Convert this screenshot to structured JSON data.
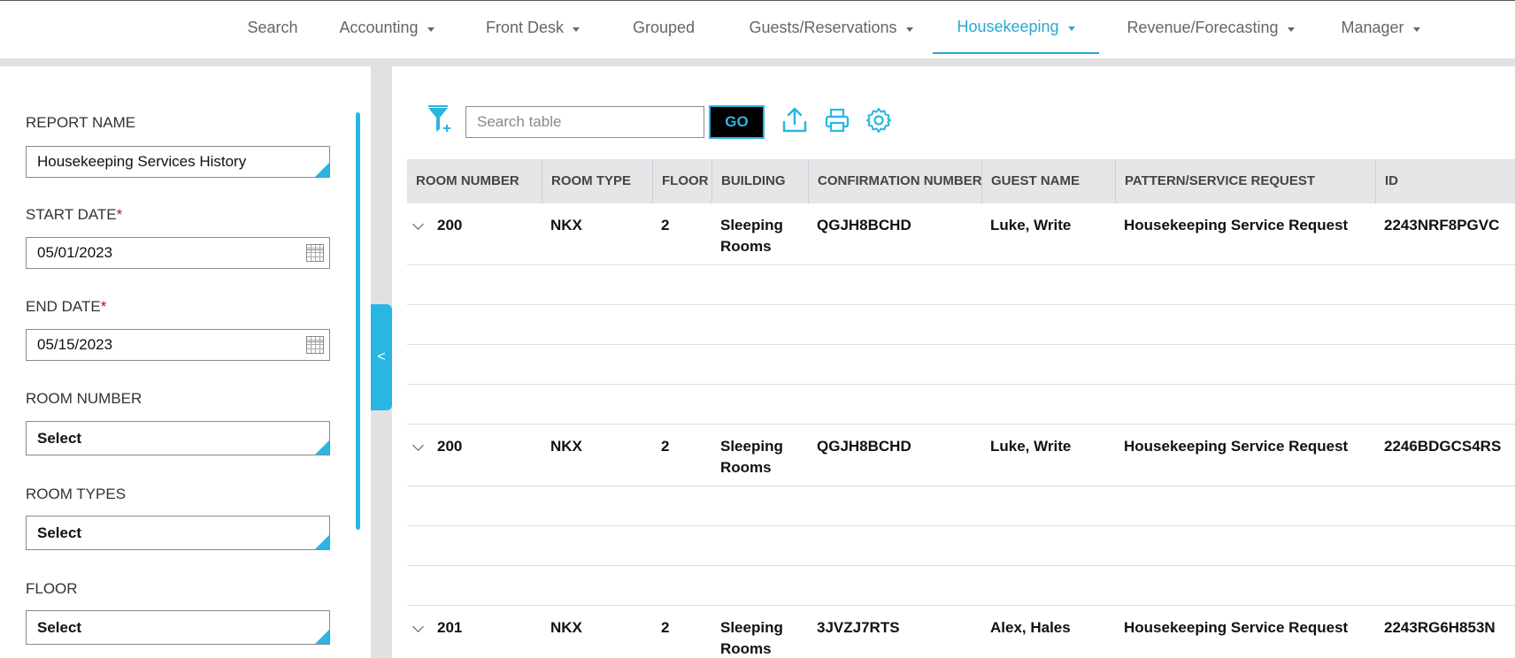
{
  "nav": {
    "items": [
      {
        "label": "Search",
        "dropdown": false,
        "active": false
      },
      {
        "label": "Accounting",
        "dropdown": true,
        "active": false
      },
      {
        "label": "Front Desk",
        "dropdown": true,
        "active": false
      },
      {
        "label": "Grouped",
        "dropdown": false,
        "active": false
      },
      {
        "label": "Guests/Reservations",
        "dropdown": true,
        "active": false
      },
      {
        "label": "Housekeeping",
        "dropdown": true,
        "active": true
      },
      {
        "label": "Revenue/Forecasting",
        "dropdown": true,
        "active": false
      },
      {
        "label": "Manager",
        "dropdown": true,
        "active": false
      }
    ]
  },
  "filters": {
    "report_name_label": "REPORT NAME",
    "report_name_value": "Housekeeping Services History",
    "start_date_label": "START DATE",
    "start_date_value": "05/01/2023",
    "end_date_label": "END DATE",
    "end_date_value": "05/15/2023",
    "required_mark": "*",
    "room_number_label": "ROOM NUMBER",
    "room_number_value": "Select",
    "room_types_label": "ROOM TYPES",
    "room_types_value": "Select",
    "floor_label": "FLOOR",
    "floor_value": "Select"
  },
  "collapse_glyph": "<",
  "toolbar": {
    "search_placeholder": "Search table",
    "go_label": "GO"
  },
  "table": {
    "columns": [
      "ROOM NUMBER",
      "ROOM TYPE",
      "FLOOR",
      "BUILDING",
      "CONFIRMATION NUMBER",
      "GUEST NAME",
      "PATTERN/SERVICE REQUEST",
      "ID"
    ],
    "rows": [
      {
        "room": "200",
        "type": "NKX",
        "floor": "2",
        "building": "Sleeping Rooms",
        "confirmation": "QGJH8BCHD",
        "guest": "Luke, Write",
        "request": "Housekeeping Service Request",
        "id": "2243NRF8PGVC"
      },
      {
        "room": "200",
        "type": "NKX",
        "floor": "2",
        "building": "Sleeping Rooms",
        "confirmation": "QGJH8BCHD",
        "guest": "Luke, Write",
        "request": "Housekeeping Service Request",
        "id": "2246BDGCS4RS"
      },
      {
        "room": "201",
        "type": "NKX",
        "floor": "2",
        "building": "Sleeping Rooms",
        "confirmation": "3JVZJ7RTS",
        "guest": "Alex, Hales",
        "request": "Housekeeping Service Request",
        "id": "2243RG6H853N"
      }
    ]
  },
  "colors": {
    "accent": "#29b6e3",
    "active_nav": "#2aa7d3",
    "required": "#d0021b"
  }
}
